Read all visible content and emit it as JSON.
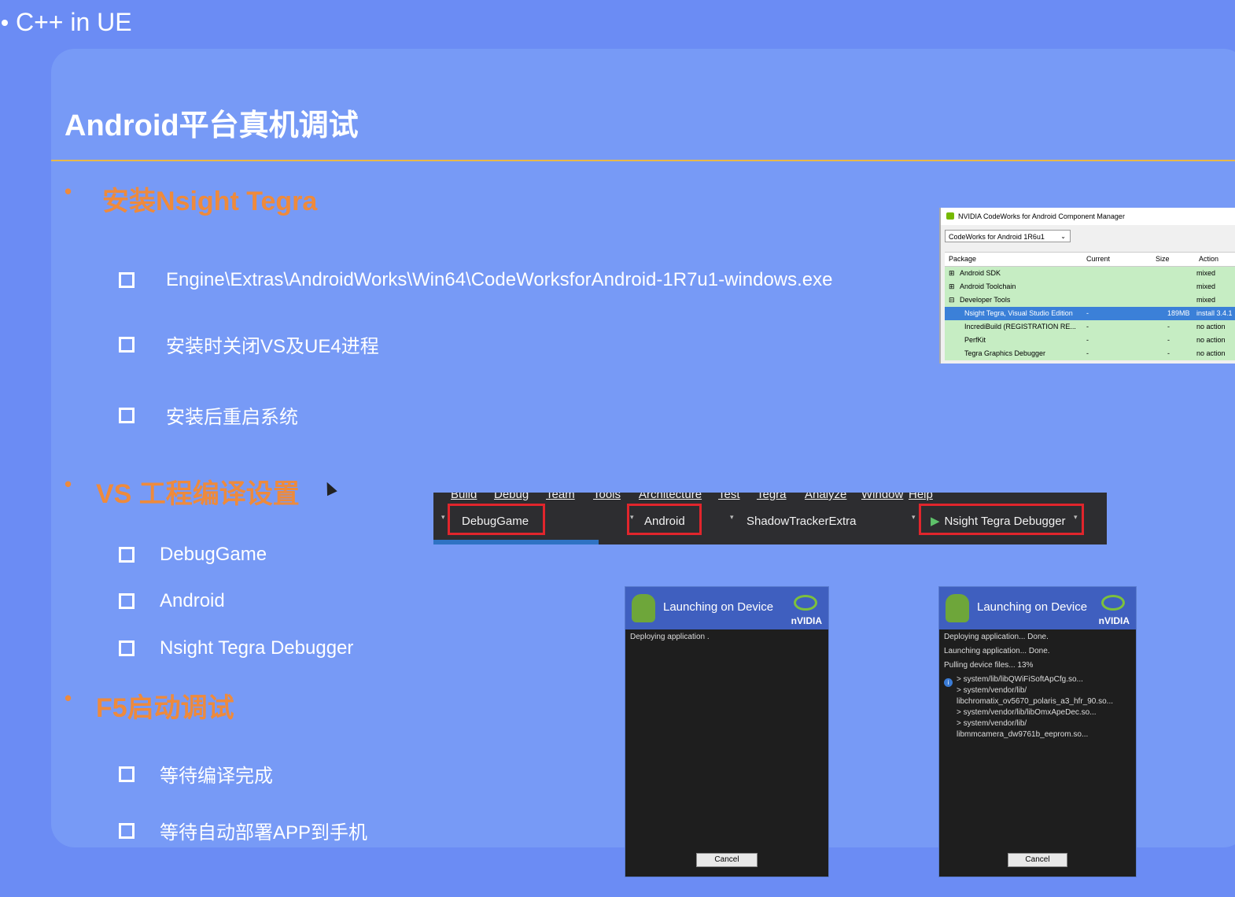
{
  "header": {
    "breadcrumb": "C++ in UE",
    "title": "Android平台真机调试"
  },
  "sections": [
    {
      "heading": "安装Nsight Tegra",
      "items": [
        "Engine\\Extras\\AndroidWorks\\Win64\\CodeWorksforAndroid-1R7u1-windows.exe",
        "安装时关闭VS及UE4进程",
        "安装后重启系统"
      ]
    },
    {
      "heading": "VS 工程编译设置",
      "items": [
        "DebugGame",
        "Android",
        "Nsight Tegra Debugger"
      ]
    },
    {
      "heading": "F5启动调试",
      "items": [
        "等待编译完成",
        "等待自动部署APP到手机"
      ]
    }
  ],
  "component_manager": {
    "window_title": "NVIDIA CodeWorks for Android Component Manager",
    "selected_version": "CodeWorks for Android 1R6u1",
    "columns": [
      "Package",
      "Current",
      "Size",
      "Action"
    ],
    "rows": [
      {
        "tree": "⊞",
        "package": "Android SDK",
        "current": "",
        "size": "",
        "action": "mixed"
      },
      {
        "tree": "⊞",
        "package": "Android Toolchain",
        "current": "",
        "size": "",
        "action": "mixed"
      },
      {
        "tree": "⊟",
        "package": "Developer Tools",
        "current": "",
        "size": "",
        "action": "mixed"
      },
      {
        "tree": "",
        "package": "Nsight Tegra, Visual Studio Edition",
        "current": "-",
        "size": "189MB",
        "action": "install 3.4.1"
      },
      {
        "tree": "",
        "package": "IncrediBuild (REGISTRATION RE...",
        "current": "-",
        "size": "-",
        "action": "no action"
      },
      {
        "tree": "",
        "package": "PerfKit",
        "current": "-",
        "size": "-",
        "action": "no action"
      },
      {
        "tree": "",
        "package": "Tegra Graphics Debugger",
        "current": "-",
        "size": "-",
        "action": "no action"
      }
    ]
  },
  "vs_toolbar": {
    "menu": [
      "Build",
      "Debug",
      "Team",
      "Tools",
      "Architecture",
      "Test",
      "Tegra",
      "Analyze",
      "Window",
      "Help"
    ],
    "configuration": "DebugGame",
    "platform": "Android",
    "project": "ShadowTrackerExtra",
    "debugger": "Nsight Tegra Debugger"
  },
  "dialog_left": {
    "title": "Launching on Device",
    "brand": "nVIDIA",
    "lines": [
      "Deploying application ."
    ],
    "cancel": "Cancel"
  },
  "dialog_right": {
    "title": "Launching on Device",
    "brand": "nVIDIA",
    "lines": [
      "Deploying application... Done.",
      "Launching application... Done.",
      "Pulling device files... 13%",
      "> system/lib/libQWiFiSoftApCfg.so...",
      "> system/vendor/lib/",
      "libchromatix_ov5670_polaris_a3_hfr_90.so...",
      "> system/vendor/lib/libOmxApeDec.so...",
      "> system/vendor/lib/",
      "libmmcamera_dw9761b_eeprom.so..."
    ],
    "cancel": "Cancel"
  },
  "colors": {
    "background": "#6b8cf4",
    "panel": "#779af6",
    "accent": "#ee8a3c",
    "rule": "#e8b84a",
    "highlight": "#e1252c"
  }
}
